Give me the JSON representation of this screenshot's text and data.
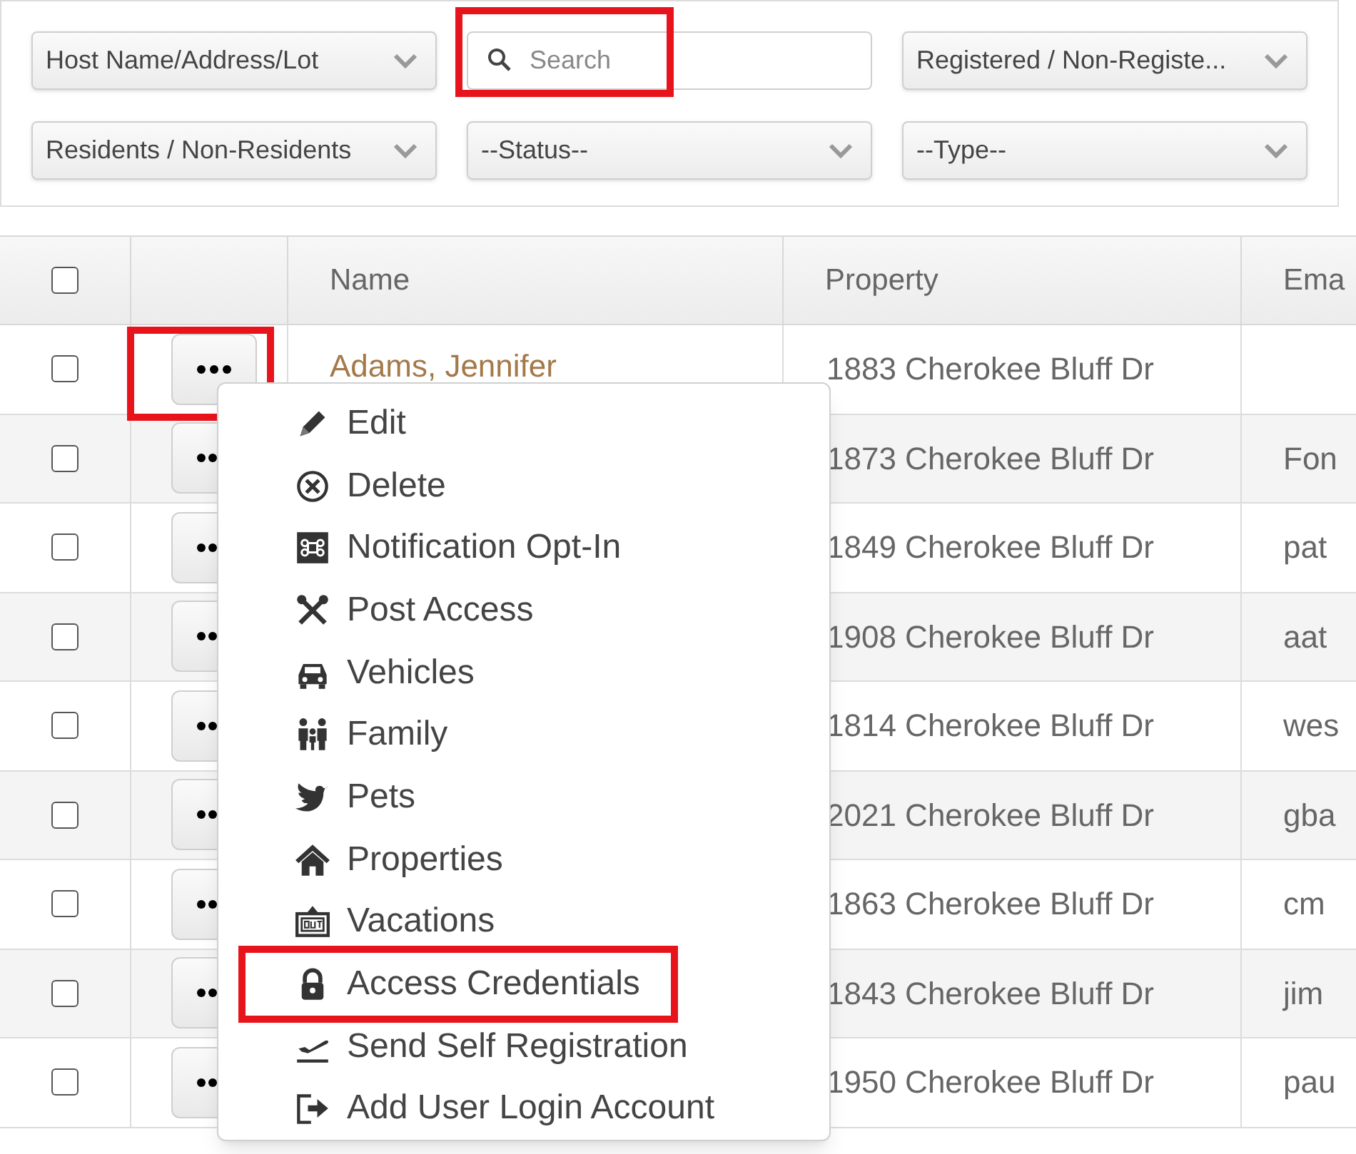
{
  "filters": [
    {
      "kind": "select",
      "value": "Host Name/Address/Lot",
      "highlighted": false
    },
    {
      "kind": "search",
      "placeholder": "Search",
      "highlighted": true
    },
    {
      "kind": "select",
      "value": "Registered / Non-Registe...",
      "highlighted": false
    },
    {
      "kind": "select",
      "value": "Residents / Non-Residents",
      "highlighted": false
    },
    {
      "kind": "select",
      "value": "--Status--",
      "highlighted": false
    },
    {
      "kind": "select",
      "value": "--Type--",
      "highlighted": false
    }
  ],
  "table": {
    "header_checked": false,
    "columns": [
      "Name",
      "Property",
      "Ema"
    ],
    "rows": [
      {
        "checked": false,
        "actions_highlighted": true,
        "name": "Adams, Jennifer",
        "property": "1883 Cherokee Bluff Dr",
        "email": ""
      },
      {
        "checked": false,
        "actions_highlighted": false,
        "property": "1873 Cherokee Bluff Dr",
        "email": "Fon"
      },
      {
        "checked": false,
        "actions_highlighted": false,
        "property": "1849 Cherokee Bluff Dr",
        "email": "pat"
      },
      {
        "checked": false,
        "actions_highlighted": false,
        "property": "1908 Cherokee Bluff Dr",
        "email": "aat"
      },
      {
        "checked": false,
        "actions_highlighted": false,
        "property": "1814 Cherokee Bluff Dr",
        "email": "wes"
      },
      {
        "checked": false,
        "actions_highlighted": false,
        "property": "2021 Cherokee Bluff Dr",
        "email": "gba"
      },
      {
        "checked": false,
        "actions_highlighted": false,
        "property": "1863 Cherokee Bluff Dr",
        "email": "cm"
      },
      {
        "checked": false,
        "actions_highlighted": false,
        "property": "1843 Cherokee Bluff Dr",
        "email": "jim"
      },
      {
        "checked": false,
        "actions_highlighted": false,
        "property": "1950 Cherokee Bluff Dr",
        "email": "pau"
      }
    ]
  },
  "context_menu": {
    "items": [
      {
        "kind": "edit",
        "label": "Edit",
        "highlighted": false
      },
      {
        "kind": "delete",
        "label": "Delete",
        "highlighted": false
      },
      {
        "kind": "notification",
        "label": "Notification Opt-In",
        "highlighted": false
      },
      {
        "kind": "tools",
        "label": "Post Access",
        "highlighted": false
      },
      {
        "kind": "car",
        "label": "Vehicles",
        "highlighted": false
      },
      {
        "kind": "family",
        "label": "Family",
        "highlighted": false
      },
      {
        "kind": "bird",
        "label": "Pets",
        "highlighted": false
      },
      {
        "kind": "house",
        "label": "Properties",
        "highlighted": false
      },
      {
        "kind": "out",
        "label": "Vacations",
        "highlighted": false
      },
      {
        "kind": "lock",
        "label": "Access Credentials",
        "highlighted": true
      },
      {
        "kind": "plane",
        "label": "Send Self Registration",
        "highlighted": false
      },
      {
        "kind": "login",
        "label": "Add User Login Account",
        "highlighted": false
      }
    ]
  }
}
